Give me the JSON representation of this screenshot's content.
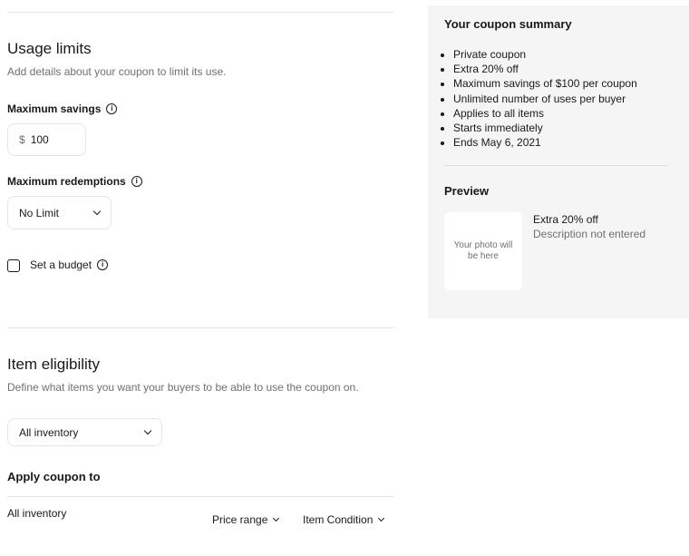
{
  "usage": {
    "title": "Usage limits",
    "subtitle": "Add details about your coupon to limit its use.",
    "max_savings_label": "Maximum savings",
    "max_savings_prefix": "$",
    "max_savings_value": "100",
    "max_redemptions_label": "Maximum redemptions",
    "max_redemptions_value": "No Limit",
    "budget_label": "Set a budget",
    "budget_checked": false
  },
  "eligibility": {
    "title": "Item eligibility",
    "subtitle": "Define what items you want your buyers to be able to use the coupon on.",
    "inventory_value": "All inventory",
    "apply_title": "Apply coupon to",
    "apply_value": "All inventory",
    "filter_price": "Price range",
    "filter_condition": "Item Condition"
  },
  "summary": {
    "title": "Your coupon summary",
    "items": [
      "Private coupon",
      "Extra 20% off",
      "Maximum savings of $100 per coupon",
      "Unlimited number of uses per buyer",
      "Applies to all items",
      "Starts immediately",
      "Ends May 6, 2021"
    ],
    "preview_title": "Preview",
    "photo_placeholder": "Your photo will be here",
    "preview_offer": "Extra 20% off",
    "preview_description": "Description not entered"
  },
  "icons": {
    "info": "info-icon",
    "chevron": "chevron-down-icon"
  },
  "colors": {
    "text": "#191919",
    "muted": "#707070",
    "panel": "#f5f5f5",
    "border": "#e5e5e5"
  }
}
